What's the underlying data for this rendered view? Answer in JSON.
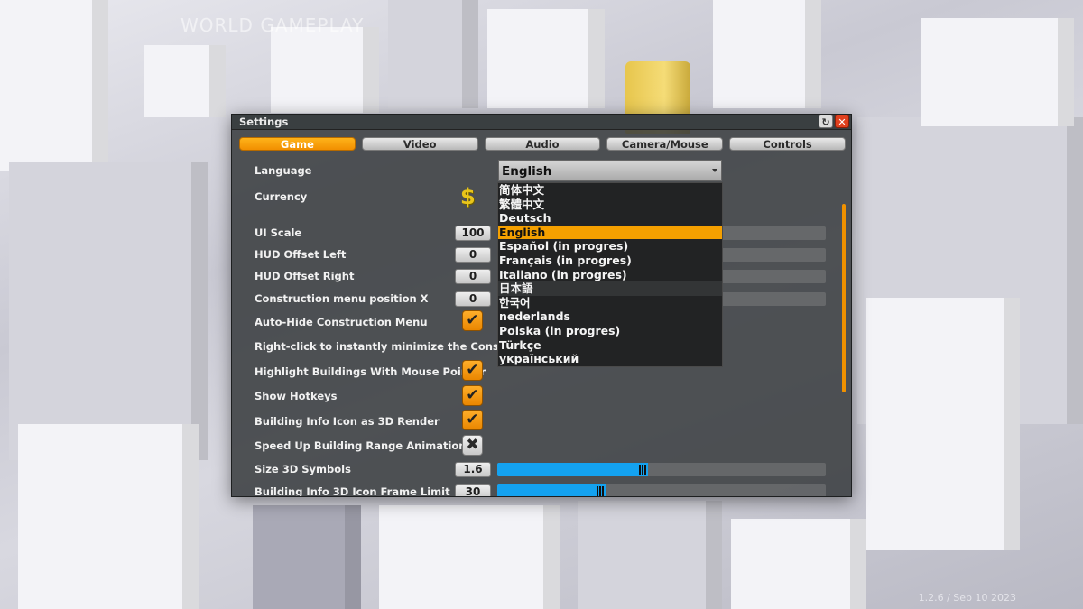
{
  "background": {
    "faded_title": "WORLD GAMEPLAY",
    "version": "1.2.6 / Sep 10 2023"
  },
  "window": {
    "title": "Settings",
    "reset_icon": "↻",
    "close_icon": "✕"
  },
  "tabs": [
    {
      "label": "Game"
    },
    {
      "label": "Video"
    },
    {
      "label": "Audio"
    },
    {
      "label": "Camera/Mouse"
    },
    {
      "label": "Controls"
    }
  ],
  "settings": {
    "language_label": "Language",
    "language_value": "English",
    "currency_label": "Currency",
    "currency_symbol": "$",
    "ui_scale_label": "UI Scale",
    "ui_scale_value": "100",
    "hud_left_label": "HUD Offset Left",
    "hud_left_value": "0",
    "hud_right_label": "HUD Offset Right",
    "hud_right_value": "0",
    "construction_x_label": "Construction menu position X",
    "construction_x_value": "0",
    "auto_hide_label": "Auto-Hide Construction Menu",
    "right_click_label": "Right-click to instantly minimize the Construction",
    "highlight_label": "Highlight Buildings With Mouse Pointer",
    "hotkeys_label": "Show Hotkeys",
    "info_icon_label": "Building Info Icon as 3D Render",
    "speed_up_label": "Speed Up Building Range Animation",
    "size3d_label": "Size 3D Symbols",
    "size3d_value": "1.6",
    "size3d_fill": 0.46,
    "frame_limit_label": "Building Info 3D Icon Frame Limit",
    "frame_limit_value": "30",
    "frame_limit_fill": 0.33,
    "check_on": "✔",
    "check_off": "✖"
  },
  "language_options": [
    "简体中文",
    "繁體中文",
    "Deutsch",
    "English",
    "Español (in progres)",
    "Français (in progres)",
    "Italiano (in progres)",
    "日本語",
    "한국어",
    "nederlands",
    "Polska (in progres)",
    "Türkçe",
    "український"
  ],
  "colors": {
    "accent": "#f5a000",
    "slider": "#14a2f0"
  }
}
